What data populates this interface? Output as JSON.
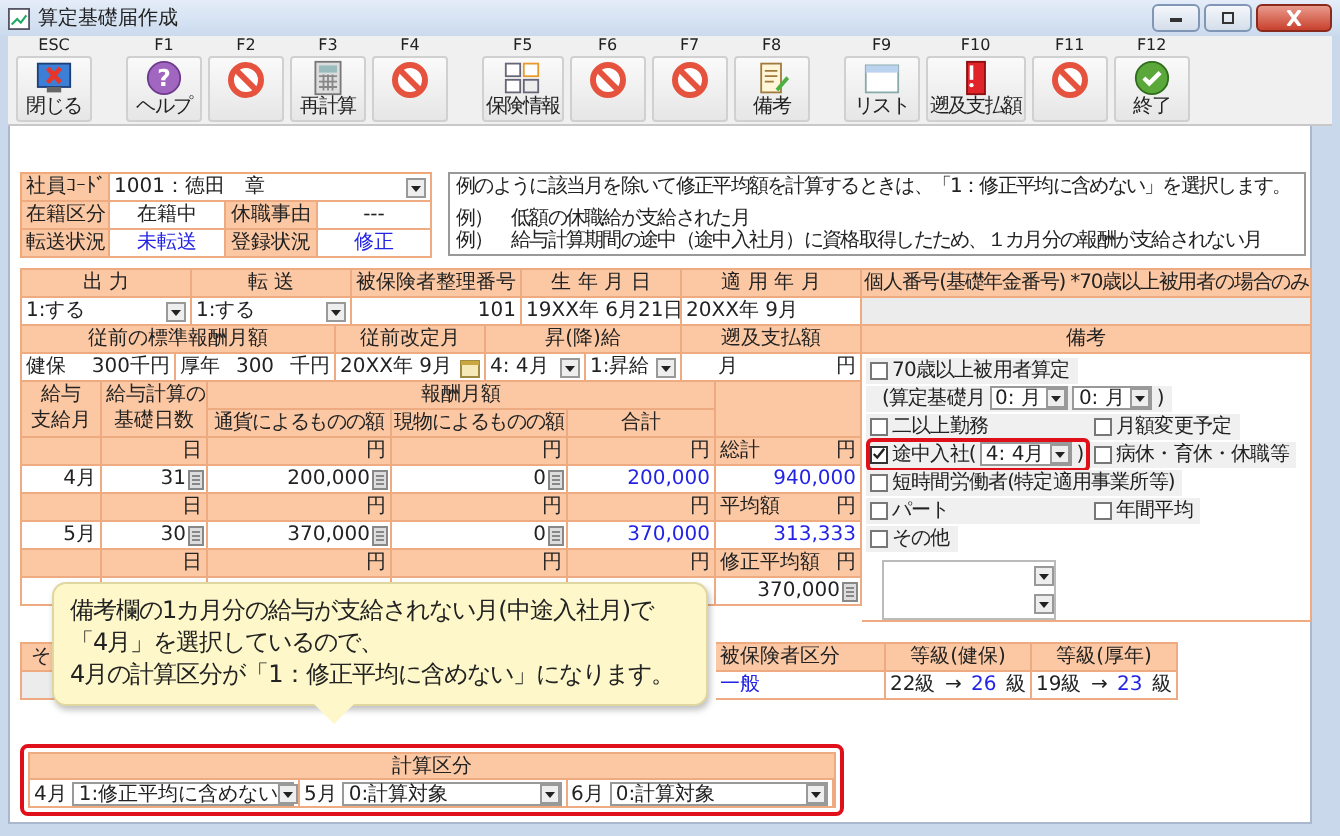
{
  "window": {
    "title": "算定基礎届作成"
  },
  "toolbar": [
    {
      "key": "ESC",
      "kind": "close",
      "label": "閉じる"
    },
    {
      "key": "F1",
      "kind": "help",
      "label": "ヘルプ",
      "glyph": "?"
    },
    {
      "key": "F2",
      "kind": "disabled"
    },
    {
      "key": "F3",
      "kind": "calculator",
      "label": "再計算"
    },
    {
      "key": "F4",
      "kind": "disabled"
    },
    {
      "key": "F5",
      "kind": "insurance",
      "label": "保険情報"
    },
    {
      "key": "F6",
      "kind": "disabled"
    },
    {
      "key": "F7",
      "kind": "disabled"
    },
    {
      "key": "F8",
      "kind": "memo",
      "label": "備考"
    },
    {
      "key": "F9",
      "kind": "list",
      "label": "リスト"
    },
    {
      "key": "F10",
      "kind": "binder",
      "label": "遡及支払額"
    },
    {
      "key": "F11",
      "kind": "disabled"
    },
    {
      "key": "F12",
      "kind": "finish",
      "label": "終了"
    }
  ],
  "employee": {
    "code_label": "社員ｺｰﾄﾞ",
    "code_value": "1001：徳田　章",
    "status_label": "在籍区分",
    "status_value": "在籍中",
    "leave_label": "休職事由",
    "leave_value": "---",
    "transfer_label": "転送状況",
    "transfer_value": "未転送",
    "registration_label": "登録状況",
    "registration_value": "修正"
  },
  "note": {
    "lines": [
      "例のように該当月を除いて修正平均額を計算するときは、「1：修正平均に含めない」を選択します。",
      "例）　低額の休職給が支給された月",
      "例）　給与計算期間の途中（途中入社月）に資格取得したため、１カ月分の報酬が支給されない月"
    ]
  },
  "basic": {
    "output_label": "出 力",
    "output_value": "1:する",
    "transfer_label": "転 送",
    "transfer_value": "1:する",
    "insured_no_label": "被保険者整理番号",
    "insured_no": "101",
    "birth_label": "生 年 月 日",
    "birth": "19XX年 6月21日",
    "apply_label": "適 用 年 月",
    "apply": "20XX年 9月",
    "my_number_label": "個人番号(基礎年金番号) *70歳以上被用者の場合のみ"
  },
  "previous": {
    "standard_label": "従前の標準報酬月額",
    "health_label": "健保",
    "health_value": "300千円",
    "pension_label": "厚年",
    "pension_value": "300",
    "pension_unit": "千円",
    "revision_label": "従前改定月",
    "revision": "20XX年 9月",
    "raise_label": "昇(降)給",
    "raise_month": "4: 4月",
    "raise_type": "1:昇給",
    "retro_label": "遡及支払額",
    "retro_month_unit": "月",
    "retro_yen_unit": "円"
  },
  "monthly": {
    "month_header": [
      "給与",
      "支給月"
    ],
    "days_header": [
      "給与計算の",
      "基礎日数"
    ],
    "pay_header": "報酬月額",
    "cash_header": "通貨によるものの額",
    "kind_header": "現物によるものの額",
    "total_header": "合計",
    "rows": [
      {
        "day_unit": "日",
        "cash_unit": "円",
        "kind_unit": "円",
        "total_unit": "円",
        "month": "4月",
        "days": "31",
        "cash": "200,000",
        "in_kind": "0",
        "total": "200,000"
      },
      {
        "day_unit": "日",
        "cash_unit": "円",
        "kind_unit": "円",
        "total_unit": "円",
        "month": "5月",
        "days": "30",
        "cash": "370,000",
        "in_kind": "0",
        "total": "370,000"
      },
      {
        "day_unit": "日",
        "cash_unit": "円",
        "kind_unit": "円",
        "total_unit": "円"
      }
    ],
    "summary": [
      {
        "label": "総計",
        "unit": "円",
        "value": "940,000",
        "kind": "computed"
      },
      {
        "label": "平均額",
        "unit": "円",
        "value": "313,333",
        "kind": "computed"
      },
      {
        "label": "修正平均額",
        "unit": "円",
        "value": "370,000",
        "kind": "input"
      }
    ]
  },
  "remarks": {
    "header": "備考",
    "rows": [
      [
        {
          "kind": "check",
          "label": "70歳以上被用者算定",
          "checked": false,
          "highlighted": false
        }
      ],
      [
        {
          "kind": "months",
          "prefix": "(算定基礎月",
          "selects": [
            "0: 月",
            "0: 月"
          ],
          "suffix": ")",
          "highlighted": false
        }
      ],
      [
        {
          "kind": "check",
          "label": "二以上勤務",
          "checked": false,
          "highlighted": false
        },
        {
          "kind": "check",
          "label": "月額変更予定",
          "checked": false,
          "highlighted": false
        }
      ],
      [
        {
          "kind": "check_select",
          "label": "途中入社(",
          "value": "4: 4月",
          "suffix": ")",
          "checked": true,
          "highlighted": true
        },
        {
          "kind": "check",
          "label": "病休・育休・休職等",
          "checked": false,
          "highlighted": false
        }
      ],
      [
        {
          "kind": "check",
          "label": "短時間労働者(特定適用事業所等)",
          "checked": false,
          "highlighted": false
        }
      ],
      [
        {
          "kind": "check",
          "label": "パート",
          "checked": false,
          "highlighted": false
        },
        {
          "kind": "check",
          "label": "年間平均",
          "checked": false,
          "highlighted": false
        }
      ],
      [
        {
          "kind": "check",
          "label": "その他",
          "checked": false,
          "highlighted": false
        }
      ]
    ]
  },
  "other_row": {
    "label": "そ"
  },
  "insured": {
    "type_label": "被保険者区分",
    "type_value": "一般",
    "grades": [
      {
        "label": "等級(健保)",
        "from": "22級",
        "arrow": "→",
        "to": "26",
        "unit": "級"
      },
      {
        "label": "等級(厚年)",
        "from": "19級",
        "arrow": "→",
        "to": "23",
        "unit": "級"
      }
    ]
  },
  "callout": {
    "lines": [
      "備考欄の1カ月分の給与が支給されない月(中途入社月)で",
      "「4月」を選択しているので、",
      "4月の計算区分が「1：修正平均に含めない」になります。"
    ]
  },
  "calc": {
    "header": "計算区分",
    "highlighted": true,
    "months": [
      {
        "month": "4月",
        "value": "1:修正平均に含めない"
      },
      {
        "month": "5月",
        "value": "0:計算対象"
      },
      {
        "month": "6月",
        "value": "0:計算対象"
      }
    ]
  }
}
